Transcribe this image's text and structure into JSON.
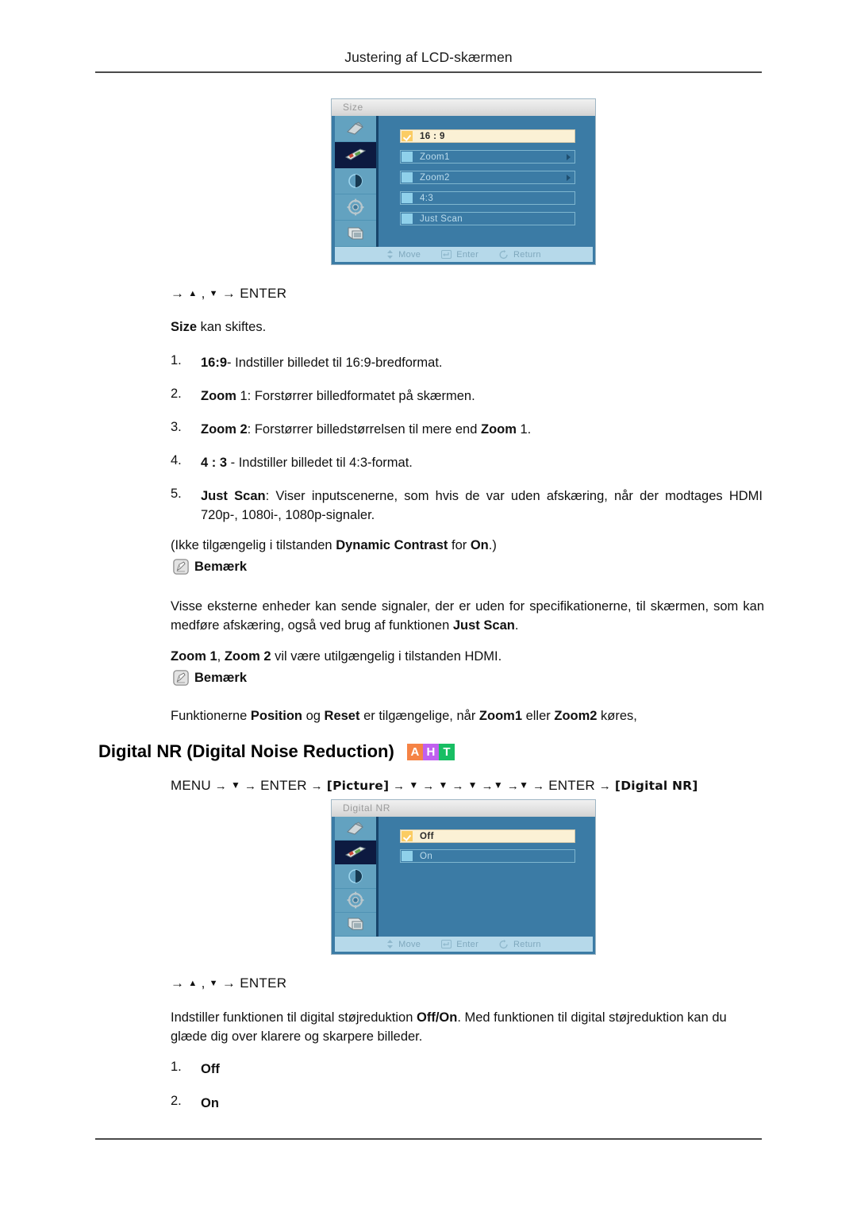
{
  "header": {
    "title": "Justering af LCD-skærmen"
  },
  "size_section": {
    "osd": {
      "title": "Size",
      "rows": [
        {
          "label": "16 : 9",
          "selected": true,
          "arrow": false
        },
        {
          "label": "Zoom1",
          "selected": false,
          "arrow": true
        },
        {
          "label": "Zoom2",
          "selected": false,
          "arrow": true
        },
        {
          "label": "4:3",
          "selected": false,
          "arrow": false
        },
        {
          "label": "Just Scan",
          "selected": false,
          "arrow": false
        }
      ],
      "footer": [
        {
          "icon": "move-icon",
          "label": "Move"
        },
        {
          "icon": "enter-icon",
          "label": "Enter"
        },
        {
          "icon": "return-icon",
          "label": "Return"
        }
      ],
      "sidebar_icons": [
        "input-icon",
        "picture-icon",
        "sound-icon",
        "setup-icon",
        "multi-control-icon"
      ],
      "selected_sidebar_index": 1
    },
    "key_hint": {
      "arrow1": "→",
      "up": "▲",
      "comma": ",",
      "down": "▼",
      "arrow2": "→",
      "enter": "ENTER"
    },
    "intro_bold": "Size",
    "intro_rest": " kan skiftes.",
    "items": [
      {
        "num": "1.",
        "parts": [
          {
            "t": "16:9",
            "b": true
          },
          {
            "t": "- Indstiller billedet til 16:9-bredformat.",
            "b": false
          }
        ]
      },
      {
        "num": "2.",
        "parts": [
          {
            "t": "Zoom",
            "b": true
          },
          {
            "t": " 1: Forstørrer billedformatet på skærmen.",
            "b": false
          }
        ]
      },
      {
        "num": "3.",
        "parts": [
          {
            "t": "Zoom 2",
            "b": true
          },
          {
            "t": ": Forstørrer billedstørrelsen til mere end ",
            "b": false
          },
          {
            "t": "Zoom",
            "b": true
          },
          {
            "t": " 1.",
            "b": false
          }
        ]
      },
      {
        "num": "4.",
        "parts": [
          {
            "t": "4 : 3",
            "b": true
          },
          {
            "t": " - Indstiller billedet til 4:3-format.",
            "b": false
          }
        ]
      },
      {
        "num": "5.",
        "parts": [
          {
            "t": "Just Scan",
            "b": true
          },
          {
            "t": ": Viser inputscenerne, som hvis de var uden afskæring, når der modtages HDMI 720p-, 1080i-, 1080p-signaler.",
            "b": false
          }
        ]
      }
    ],
    "note1": {
      "lead_parts": [
        {
          "t": "(Ikke tilgængelig i tilstanden ",
          "b": false
        },
        {
          "t": "Dynamic Contrast",
          "b": true
        },
        {
          "t": " for ",
          "b": false
        },
        {
          "t": "On",
          "b": true
        },
        {
          "t": ".)",
          "b": false
        }
      ],
      "icon": "note-pencil-icon",
      "label": "Bemærk",
      "body_parts": [
        {
          "t": "Visse eksterne enheder kan sende signaler, der er uden for specifikationerne, til skærmen, som kan medføre afskæring, også ved brug af funktionen ",
          "b": false
        },
        {
          "t": "Just Scan",
          "b": true
        },
        {
          "t": ".",
          "b": false
        }
      ]
    },
    "note2": {
      "lead_parts": [
        {
          "t": "Zoom 1",
          "b": true
        },
        {
          "t": ", ",
          "b": false
        },
        {
          "t": "Zoom 2",
          "b": true
        },
        {
          "t": " vil være utilgængelig i tilstanden HDMI.",
          "b": false
        }
      ],
      "icon": "note-pencil-icon",
      "label": "Bemærk",
      "body_parts": [
        {
          "t": "Funktionerne ",
          "b": false
        },
        {
          "t": "Position",
          "b": true
        },
        {
          "t": " og ",
          "b": false
        },
        {
          "t": "Reset",
          "b": true
        },
        {
          "t": " er tilgængelige, når ",
          "b": false
        },
        {
          "t": "Zoom1",
          "b": true
        },
        {
          "t": " eller ",
          "b": false
        },
        {
          "t": "Zoom2",
          "b": true
        },
        {
          "t": " køres,",
          "b": false
        }
      ]
    }
  },
  "digital_nr_section": {
    "heading": "Digital NR (Digital Noise Reduction)",
    "badges": [
      {
        "letter": "A",
        "color": "#F58345"
      },
      {
        "letter": "H",
        "color": "#C060EE"
      },
      {
        "letter": "T",
        "color": "#18BE63"
      }
    ],
    "nav_path": {
      "menu": "MENU",
      "enter1": "ENTER",
      "bracket1": "[Picture]",
      "enter2": "ENTER",
      "bracket2": "[Digital NR]",
      "arrow": "→",
      "down": "▼"
    },
    "osd": {
      "title": "Digital NR",
      "rows": [
        {
          "label": "Off",
          "selected": true,
          "arrow": false
        },
        {
          "label": "On",
          "selected": false,
          "arrow": false
        }
      ],
      "footer": [
        {
          "icon": "move-icon",
          "label": "Move"
        },
        {
          "icon": "enter-icon",
          "label": "Enter"
        },
        {
          "icon": "return-icon",
          "label": "Return"
        }
      ],
      "sidebar_icons": [
        "input-icon",
        "picture-icon",
        "sound-icon",
        "setup-icon",
        "multi-control-icon"
      ],
      "selected_sidebar_index": 1
    },
    "key_hint": {
      "arrow1": "→",
      "up": "▲",
      "comma": ",",
      "down": "▼",
      "arrow2": "→",
      "enter": "ENTER"
    },
    "description_parts": [
      {
        "t": "Indstiller funktionen til digital støjreduktion ",
        "b": false
      },
      {
        "t": "Off/On",
        "b": true
      },
      {
        "t": ". Med funktionen til digital støjreduktion kan du glæde dig over klarere og skarpere billeder.",
        "b": false
      }
    ],
    "items": [
      {
        "num": "1.",
        "label": "Off"
      },
      {
        "num": "2.",
        "label": "On"
      }
    ]
  }
}
